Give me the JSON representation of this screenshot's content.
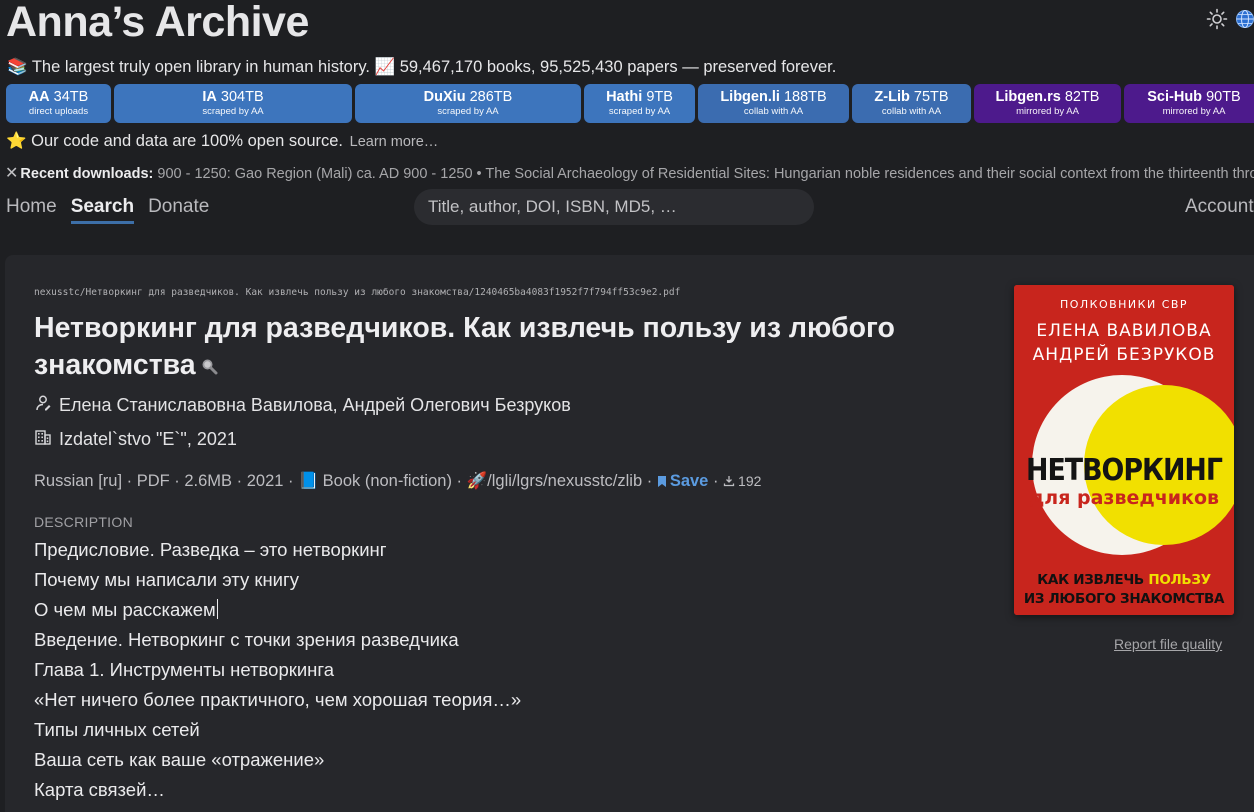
{
  "header": {
    "site_title": "Anna’s Archive",
    "tagline_icon": "📚",
    "tagline": "The largest truly open library in human history.",
    "chart_icon": "📈",
    "counts": "59,467,170 books, 95,525,430 papers — preserved forever."
  },
  "stats": [
    {
      "name": "AA",
      "size": "34TB",
      "sub": "direct uploads",
      "color": "#3d75bd"
    },
    {
      "name": "IA",
      "size": "304TB",
      "sub": "scraped by AA",
      "color": "#3d75bd"
    },
    {
      "name": "DuXiu",
      "size": "286TB",
      "sub": "scraped by AA",
      "color": "#3d75bd"
    },
    {
      "name": "Hathi",
      "size": "9TB",
      "sub": "scraped by AA",
      "color": "#3d75bd"
    },
    {
      "name": "Libgen.li",
      "size": "188TB",
      "sub": "collab with AA",
      "color": "#3b6cb0"
    },
    {
      "name": "Z-Lib",
      "size": "75TB",
      "sub": "collab with AA",
      "color": "#3b6cb0"
    },
    {
      "name": "Libgen.rs",
      "size": "82TB",
      "sub": "mirrored by AA",
      "color": "#4d1a8c"
    },
    {
      "name": "Sci-Hub",
      "size": "90TB",
      "sub": "mirrored by AA",
      "color": "#4d1a8c"
    }
  ],
  "open_source": {
    "icon": "⭐",
    "text": "Our code and data are 100% open source.",
    "link": "Learn more…"
  },
  "recent": {
    "close": "✕",
    "label": "Recent downloads:",
    "items": "900 - 1250: Gao Region (Mali) ca. AD 900 - 1250 • The Social Archaeology of Residential Sites: Hungarian noble residences and their social context from the thirteenth through to the sixteenth century"
  },
  "nav": {
    "home": "Home",
    "search": "Search",
    "donate": "Donate",
    "account": "Account"
  },
  "search": {
    "placeholder": "Title, author, DOI, ISBN, MD5, …"
  },
  "book": {
    "filepath": "nexusstc/Нетворкинг для разведчиков. Как извлечь пользу из любого знакомства/1240465ba4083f1952f7f794ff53c9e2.pdf",
    "title": "Нетворкинг для разведчиков. Как извлечь пользу из любого знакомства",
    "authors": "Елена Станиславовна Вавилова, Андрей Олегович Безруков",
    "publisher": "Izdatel`stvo \"E`\", 2021",
    "details": "Russian [ru] · PDF · 2.6MB · 2021 · ",
    "type_icon": "📘",
    "type": "Book (non-fiction)",
    "sources_icon": "🚀",
    "sources": "/lgli/lgrs/nexusstc/zlib",
    "save": "Save",
    "downloads": "192",
    "description_label": "DESCRIPTION",
    "description": [
      "Предисловие. Разведка – это нетворкинг",
      "Почему мы написали эту книгу",
      "О чем мы расскажем",
      "Введение. Нетворкинг с точки зрения разведчика",
      "Глава 1. Инструменты нетворкинга",
      "«Нет ничего более практичного, чем хорошая теория…»",
      "Типы личных сетей",
      "Ваша сеть как ваше «отражение»",
      "Карта связей…"
    ],
    "report": "Report file quality",
    "cover": {
      "series": "ПОЛКОВНИКИ СВР",
      "author1": "ЕЛЕНА ВАВИЛОВА",
      "author2": "АНДРЕЙ БЕЗРУКОВ",
      "title_big": "НЕТВОРКИНГ",
      "title_small": "для разведчиков",
      "sub1a": "КАК ИЗВЛЕЧЬ ",
      "sub1b": "ПОЛЬЗУ",
      "sub2": "ИЗ ЛЮБОГО ЗНАКОМСТВА",
      "bg": "#c8251d",
      "accent": "#f1e000"
    }
  },
  "colors": {
    "background": "#1e1f22",
    "card": "#26272b",
    "link": "#5b9be0"
  }
}
